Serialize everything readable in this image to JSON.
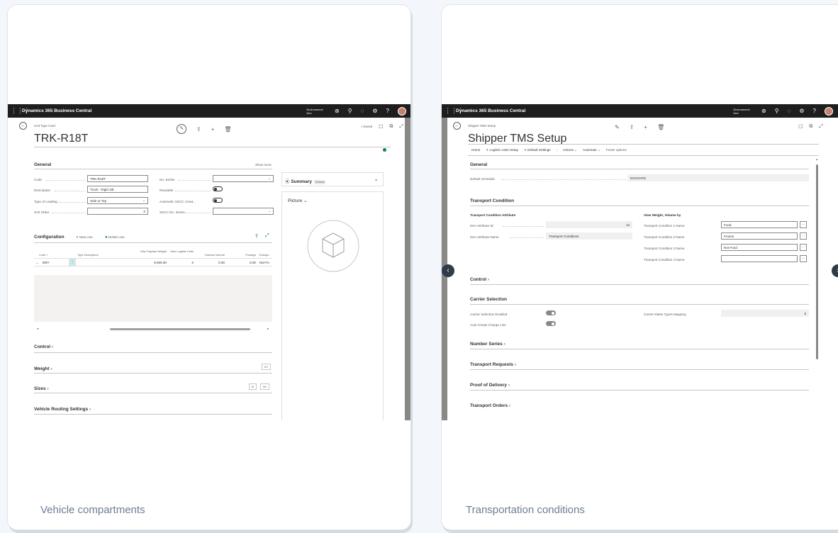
{
  "cards": [
    {
      "caption": "Vehicle compartments",
      "topbar": {
        "brand": "Dynamics 365 Business Central",
        "env_line1": "Environment:",
        "env_line2": "Dev",
        "icons": [
          "copilot-icon",
          "search-icon",
          "bell-icon",
          "settings-icon",
          "help-icon"
        ]
      },
      "crumb": "Unit Type Card",
      "title": "TRK-R18T",
      "saved": "✓Saved",
      "general": {
        "header": "General",
        "show_more": "Show more",
        "fields": [
          {
            "label": "Code",
            "value": "TRK-R18T"
          },
          {
            "label": "Description",
            "value": "Truck - Rigid 18t"
          },
          {
            "label": "Type of Loading",
            "value": "Side or Top"
          },
          {
            "label": "Sort Order",
            "value": "0"
          }
        ],
        "right_fields": [
          {
            "label": "No. Series",
            "value": ""
          },
          {
            "label": "Reusable",
            "value": ""
          },
          {
            "label": "Automatic SSCC Creat...",
            "value": ""
          },
          {
            "label": "SSCC No. Series",
            "value": ""
          }
        ]
      },
      "configuration": {
        "header": "Configuration",
        "new_line": "New Line",
        "delete_line": "Delete Line",
        "columns": [
          "Code ↑",
          "Type Description",
          "Max Payload Weight",
          "Max Logistic Units",
          "Internal Volume",
          "Footage",
          "Transpo"
        ],
        "row": [
          "DRY",
          "",
          "9,000.00",
          "0",
          "0.00",
          "0.00",
          "Not Fo"
        ]
      },
      "collapsed": [
        "Control",
        "Weight",
        "Sizes",
        "Vehicle Routing Settings"
      ],
      "weight_btn": "KG",
      "sizes_btns": [
        "M",
        "M2"
      ],
      "factbox": {
        "summary": "Summary",
        "preview": "Preview",
        "picture": "Picture"
      }
    },
    {
      "caption": "Transportation conditions",
      "topbar": {
        "brand": "Dynamics 365 Business Central",
        "env_line1": "Environment:",
        "env_line2": "Dev"
      },
      "crumb": "Shipper TMS Setup",
      "title": "Shipper TMS Setup",
      "actions": [
        "Home",
        "Logistic Units Setup",
        "Default Settings",
        "Actions",
        "Automate",
        "Fewer options"
      ],
      "general": {
        "header": "General",
        "label": "Default Schedule",
        "value": "DOCDATE"
      },
      "transport_condition": {
        "header": "Transport Condition",
        "left_head": "Transport Condition Attribute",
        "left": [
          {
            "label": "Item Attribute ID",
            "value": "13"
          },
          {
            "label": "Item Attribute Name",
            "value": "Transport Conditions"
          }
        ],
        "right_head": "View Weight, Volume by",
        "right": [
          {
            "label": "Transport Condition 1 Name",
            "value": "Food"
          },
          {
            "label": "Transport Condition 2 Name",
            "value": "Frozen"
          },
          {
            "label": "Transport Condition 3 Name",
            "value": "Not Food"
          },
          {
            "label": "Transport Condition 4 Name",
            "value": ""
          }
        ]
      },
      "control": "Control",
      "carrier": {
        "header": "Carrier Selection",
        "left": [
          {
            "label": "Carrier Selection Enabled"
          },
          {
            "label": "Auto Create Charge Line"
          }
        ],
        "right_label": "Carrier Rates Types Mapping",
        "right_value": "5"
      },
      "collapsed": [
        "Number Series",
        "Transport Requests",
        "Proof of Delivery",
        "Transport Orders"
      ]
    }
  ]
}
